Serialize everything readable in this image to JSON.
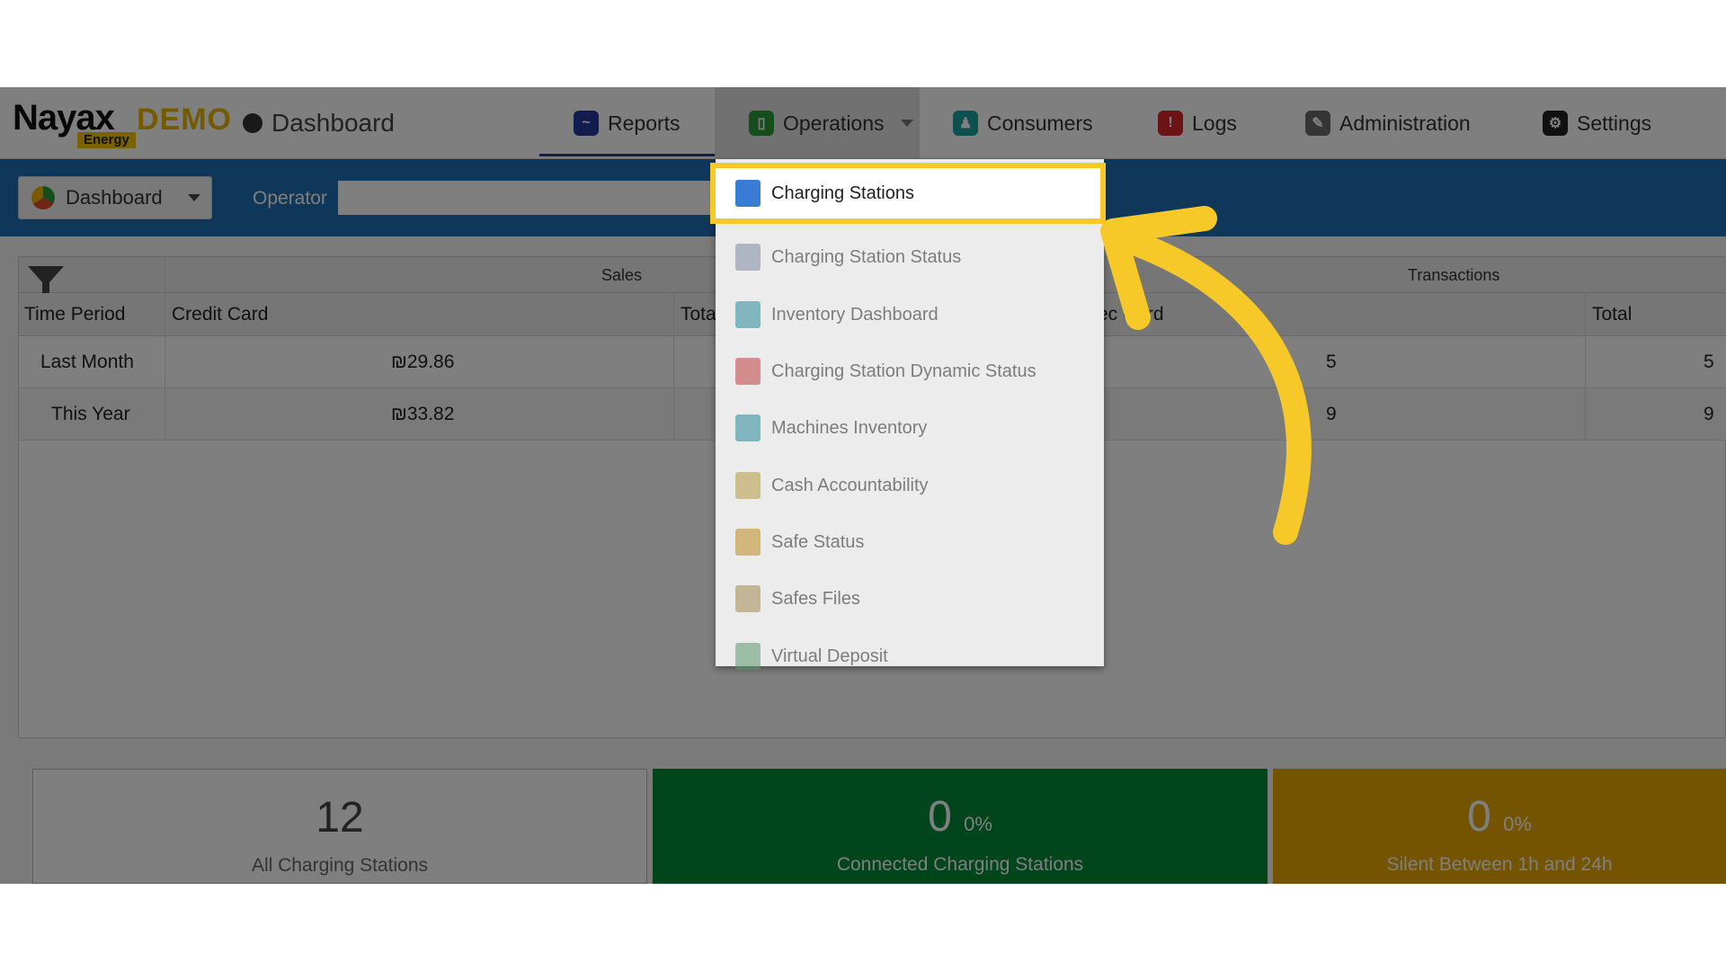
{
  "brand": {
    "name": "Nayax",
    "demo": "DEMO",
    "sub": "Energy"
  },
  "page_title": "Dashboard",
  "nav": [
    {
      "label": "Reports",
      "icon": "reports-icon",
      "color": "#243a9c"
    },
    {
      "label": "Operations",
      "icon": "operations-icon",
      "color": "#2c9a3a"
    },
    {
      "label": "Consumers",
      "icon": "consumers-icon",
      "color": "#1aa0a0"
    },
    {
      "label": "Logs",
      "icon": "logs-icon",
      "color": "#d9262c"
    },
    {
      "label": "Administration",
      "icon": "administration-icon",
      "color": "#6b6b6b"
    },
    {
      "label": "Settings",
      "icon": "settings-icon",
      "color": "#222222"
    }
  ],
  "toolbar": {
    "dashboard_label": "Dashboard",
    "operator_label": "Operator"
  },
  "table": {
    "groups": {
      "sales": "Sales",
      "transactions": "Transactions"
    },
    "headers": {
      "time_period": "Time Period",
      "credit_card": "Credit Card",
      "total": "Tota",
      "tx_credit_card": "ec Card",
      "tx_total": "Total"
    },
    "rows": [
      {
        "period": "Last Month",
        "credit": "₪29.86",
        "tx_credit": "5",
        "tx_total": "5"
      },
      {
        "period": "This Year",
        "credit": "₪33.82",
        "tx_credit": "9",
        "tx_total": "9"
      }
    ]
  },
  "cards": [
    {
      "value": "12",
      "pct": "",
      "label": "All Charging Stations"
    },
    {
      "value": "0",
      "pct": "0%",
      "label": "Connected Charging Stations"
    },
    {
      "value": "0",
      "pct": "0%",
      "label": "Silent Between 1h and 24h"
    }
  ],
  "dropdown": {
    "items": [
      {
        "label": "Charging Stations",
        "icon": "charging-stations-icon"
      },
      {
        "label": "Charging Station Status",
        "icon": "charging-station-status-icon"
      },
      {
        "label": "Inventory Dashboard",
        "icon": "inventory-dashboard-icon"
      },
      {
        "label": "Charging Station Dynamic Status",
        "icon": "dynamic-status-icon"
      },
      {
        "label": "Machines Inventory",
        "icon": "machines-inventory-icon"
      },
      {
        "label": "Cash Accountability",
        "icon": "cash-accountability-icon"
      },
      {
        "label": "Safe Status",
        "icon": "safe-status-icon"
      },
      {
        "label": "Safes Files",
        "icon": "safes-files-icon"
      },
      {
        "label": "Virtual Deposit",
        "icon": "virtual-deposit-icon"
      }
    ]
  },
  "colors": {
    "highlight": "#f7c928",
    "accent_blue": "#1f6fb2",
    "card_green": "#008a38",
    "card_yellow": "#e8a800"
  }
}
